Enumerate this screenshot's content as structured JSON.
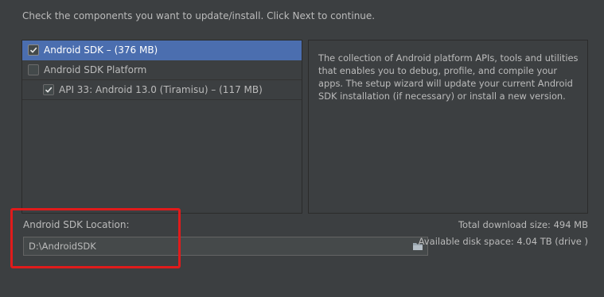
{
  "instructions": "Check the components you want to update/install. Click Next to continue.",
  "components": [
    {
      "label": "Android SDK – (376 MB)",
      "checked": true,
      "selected": true,
      "indent": 0
    },
    {
      "label": "Android SDK Platform",
      "checked": false,
      "selected": false,
      "indent": 0
    },
    {
      "label": "API 33: Android 13.0 (Tiramisu) – (117 MB)",
      "checked": true,
      "selected": false,
      "indent": 1
    }
  ],
  "description": "The collection of Android platform APIs, tools and utilities that enables you to debug, profile, and compile your apps. The setup wizard will update your current Android SDK installation (if necessary) or install a new version.",
  "sdk_location": {
    "label": "Android SDK Location:",
    "value": "D:\\AndroidSDK",
    "browse_icon": "folder-icon"
  },
  "sizes": {
    "total_download": "Total download size: 494 MB",
    "available_space": "Available disk space: 4.04 TB (drive )"
  },
  "colors": {
    "background": "#3c3f41",
    "selection": "#4b6eaf",
    "highlight": "#e01b1b",
    "text": "#bbbbbb"
  }
}
